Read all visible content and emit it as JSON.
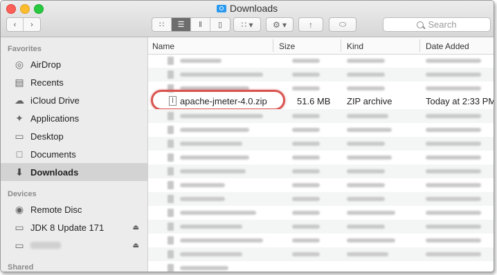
{
  "window": {
    "title": "Downloads"
  },
  "toolbar": {
    "search_placeholder": "Search"
  },
  "sidebar": {
    "favorites_header": "Favorites",
    "favorites": [
      {
        "label": "AirDrop",
        "icon": "airdrop-icon"
      },
      {
        "label": "Recents",
        "icon": "recents-icon"
      },
      {
        "label": "iCloud Drive",
        "icon": "icloud-icon"
      },
      {
        "label": "Applications",
        "icon": "applications-icon"
      },
      {
        "label": "Desktop",
        "icon": "desktop-icon"
      },
      {
        "label": "Documents",
        "icon": "documents-icon"
      },
      {
        "label": "Downloads",
        "icon": "downloads-icon",
        "selected": true
      }
    ],
    "devices_header": "Devices",
    "devices": [
      {
        "label": "Remote Disc",
        "icon": "disc-icon"
      },
      {
        "label": "JDK 8 Update 171",
        "icon": "drive-icon",
        "eject": true
      },
      {
        "label": "",
        "icon": "drive-icon",
        "eject": true,
        "blurred": true
      }
    ],
    "shared_header": "Shared"
  },
  "columns": {
    "name": "Name",
    "size": "Size",
    "kind": "Kind",
    "date": "Date Added"
  },
  "highlighted_file": {
    "name": "apache-jmeter-4.0.zip",
    "size": "51.6 MB",
    "kind": "ZIP archive",
    "date": "Today at 2:33 PM"
  },
  "colors": {
    "highlight_oval": "#d9534f",
    "selected_sidebar": "#d3d3d3"
  }
}
